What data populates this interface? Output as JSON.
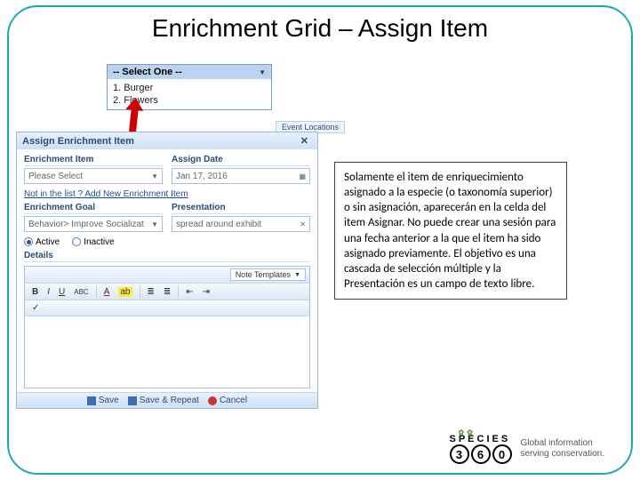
{
  "slide": {
    "title": "Enrichment Grid – Assign Item"
  },
  "dropdown": {
    "selected": "-- Select One --",
    "options": [
      "1. Burger",
      "2. Flowers"
    ]
  },
  "floating_button": "Event Locations",
  "dialog": {
    "title": "Assign Enrichment Item",
    "enrichment_item_label": "Enrichment Item",
    "enrichment_item_value": "Please Select",
    "assign_date_label": "Assign Date",
    "assign_date_value": "Jan 17, 2016",
    "add_new_link": "Not in the list ? Add New Enrichment Item",
    "enrichment_goal_label": "Enrichment Goal",
    "enrichment_goal_value": "Behavior> Improve Socializat",
    "presentation_label": "Presentation",
    "presentation_value": "spread around exhibit",
    "active_label": "Active",
    "inactive_label": "Inactive",
    "details_label": "Details",
    "note_templates_label": "Note Templates",
    "footer_save": "Save",
    "footer_save_repeat": "Save & Repeat",
    "footer_cancel": "Cancel"
  },
  "callout": {
    "text": "Solamente el item de enriquecimiento asignado a la especie (o taxonomía superior) o sin asignación, aparecerán en la celda del item Asignar. No puede crear una sesión para una fecha anterior a la que el item ha sido asignado previamente. El objetivo es una cascada de selección múltiple y la Presentación es un campo de texto libre."
  },
  "logo": {
    "brand": "SPECIES",
    "d1": "3",
    "d2": "6",
    "d3": "0",
    "tagline1": "Global information",
    "tagline2": "serving conservation."
  }
}
